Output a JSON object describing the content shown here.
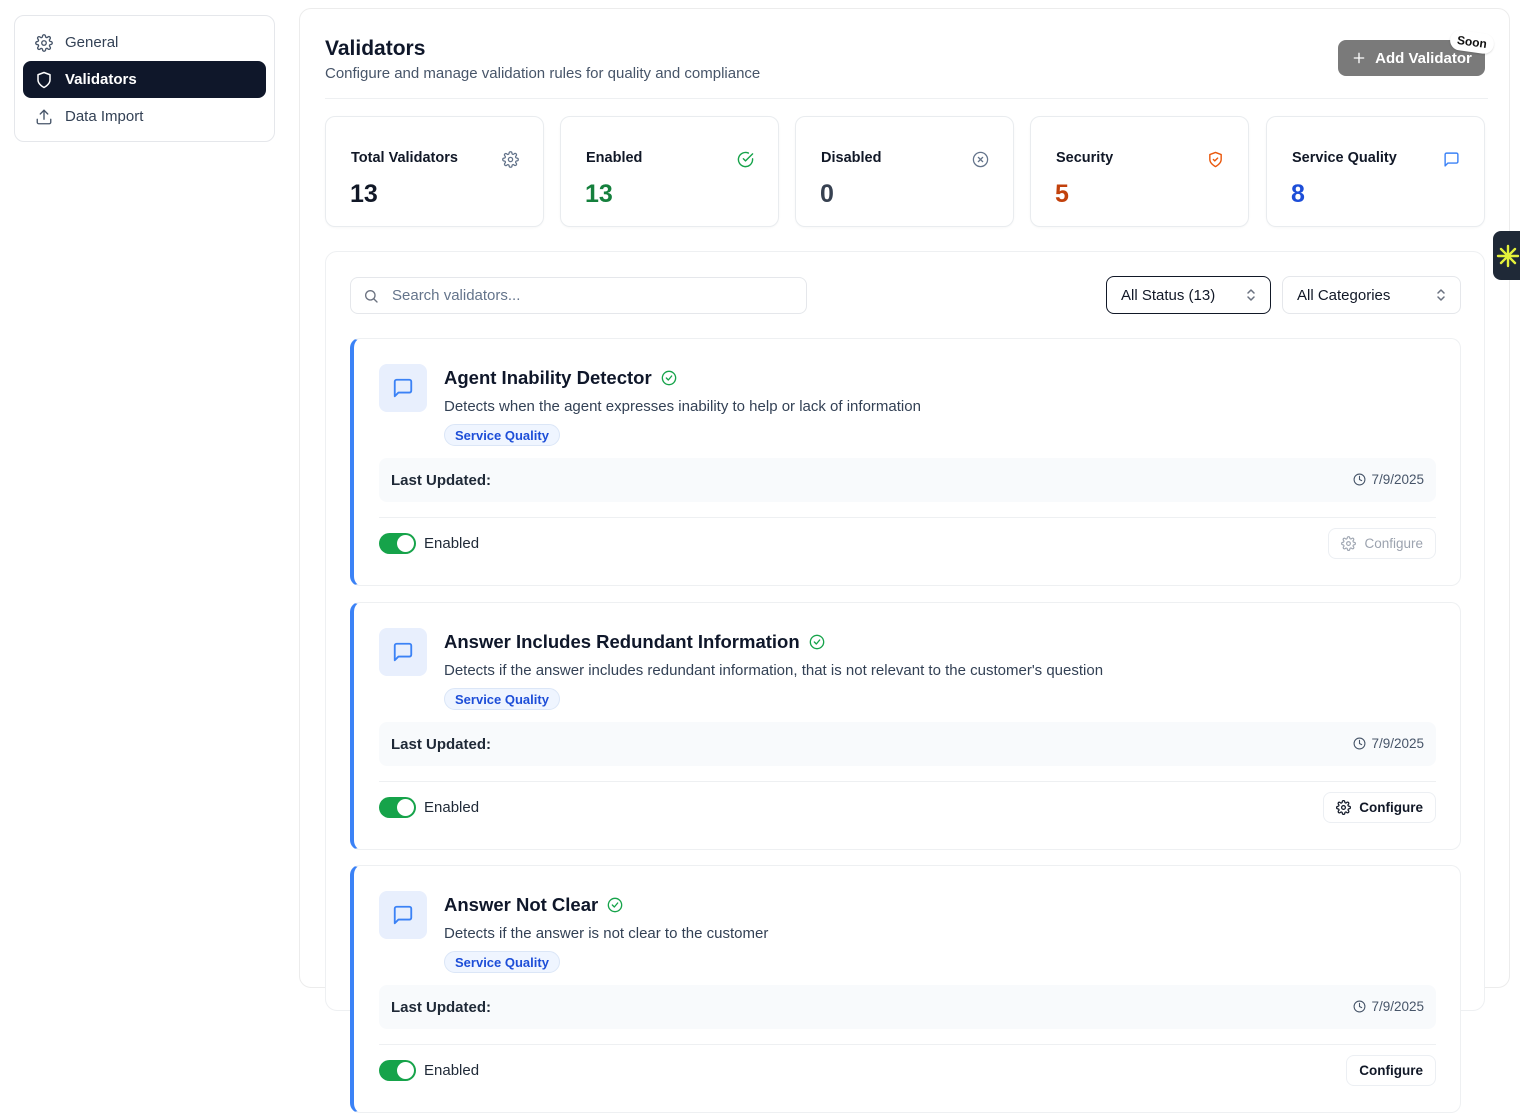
{
  "sidebar": {
    "items": [
      {
        "label": "General",
        "icon": "gear-icon",
        "active": false
      },
      {
        "label": "Validators",
        "icon": "shield-icon",
        "active": true
      },
      {
        "label": "Data Import",
        "icon": "upload-icon",
        "active": false
      }
    ]
  },
  "header": {
    "title": "Validators",
    "subtitle": "Configure and manage validation rules for quality and compliance",
    "add_button_label": "Add Validator",
    "soon_badge": "Soon"
  },
  "stats": [
    {
      "label": "Total Validators",
      "value": "13",
      "icon": "gear-icon",
      "color": "#111827"
    },
    {
      "label": "Enabled",
      "value": "13",
      "icon": "check-circle-icon",
      "color": "#15803d"
    },
    {
      "label": "Disabled",
      "value": "0",
      "icon": "x-circle-icon",
      "color": "#374151"
    },
    {
      "label": "Security",
      "value": "5",
      "icon": "shield-check-icon",
      "color": "#c2410c"
    },
    {
      "label": "Service Quality",
      "value": "8",
      "icon": "message-square-icon",
      "color": "#1d4ed8"
    }
  ],
  "filters": {
    "search_placeholder": "Search validators...",
    "status_selected": "All Status (13)",
    "category_selected": "All Categories"
  },
  "validators": [
    {
      "name": "Agent Inability Detector",
      "description": "Detects when the agent expresses inability to help or lack of information",
      "category": "Service Quality",
      "last_updated_label": "Last Updated:",
      "last_updated": "7/9/2025",
      "status_label": "Enabled",
      "configure_label": "Configure"
    },
    {
      "name": "Answer Includes Redundant Information",
      "description": "Detects if the answer includes redundant information, that is not relevant to the customer's question",
      "category": "Service Quality",
      "last_updated_label": "Last Updated:",
      "last_updated": "7/9/2025",
      "status_label": "Enabled",
      "configure_label": "Configure"
    },
    {
      "name": "Answer Not Clear",
      "description": "Detects if the answer is not clear to the customer",
      "category": "Service Quality",
      "last_updated_label": "Last Updated:",
      "last_updated": "7/9/2025",
      "status_label": "Enabled",
      "configure_label": "Configure"
    }
  ],
  "colors": {
    "accent": "#3b82f6",
    "enabled": "#16a34a",
    "nav_active_bg": "#0f172a"
  }
}
